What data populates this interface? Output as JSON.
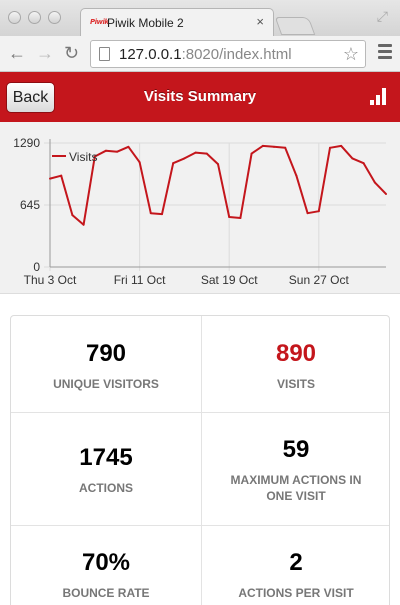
{
  "browser": {
    "tab_title": "Piwik Mobile 2",
    "tab_favicon_text": "Piwik",
    "url_host": "127.0.0.1",
    "url_rest": ":8020/index.html",
    "tab_close_glyph": "×",
    "star_glyph": "☆"
  },
  "header": {
    "back_label": "Back",
    "title": "Visits Summary",
    "bg_color": "#c4161c"
  },
  "chart_data": {
    "type": "line",
    "legend": "Visits",
    "color": "#c4161c",
    "y_ticks": [
      "0",
      "645",
      "1290"
    ],
    "ylim": [
      0,
      1290
    ],
    "x_tick_labels": [
      "Thu 3 Oct",
      "Fri 11 Oct",
      "Sat 19 Oct",
      "Sun 27 Oct"
    ],
    "x_tick_days": [
      1,
      9,
      17,
      25
    ],
    "x": [
      1,
      2,
      3,
      4,
      5,
      6,
      7,
      8,
      9,
      10,
      11,
      12,
      13,
      14,
      15,
      16,
      17,
      18,
      19,
      20,
      21,
      22,
      23,
      24,
      25,
      26,
      27,
      28,
      29,
      30,
      31
    ],
    "values": [
      920,
      950,
      540,
      440,
      1150,
      1210,
      1200,
      1250,
      1090,
      560,
      550,
      1080,
      1130,
      1190,
      1180,
      1070,
      520,
      510,
      1180,
      1260,
      1250,
      1240,
      950,
      560,
      580,
      1240,
      1260,
      1130,
      1080,
      880,
      760
    ]
  },
  "stats": [
    {
      "value": "790",
      "label": "UNIQUE VISITORS",
      "highlight": false
    },
    {
      "value": "890",
      "label": "VISITS",
      "highlight": true
    },
    {
      "value": "1745",
      "label": "ACTIONS",
      "highlight": false
    },
    {
      "value": "59",
      "label": "MAXIMUM ACTIONS IN ONE VISIT",
      "highlight": false
    },
    {
      "value": "70%",
      "label": "BOUNCE RATE",
      "highlight": false
    },
    {
      "value": "2",
      "label": "ACTIONS PER VISIT",
      "highlight": false
    }
  ]
}
